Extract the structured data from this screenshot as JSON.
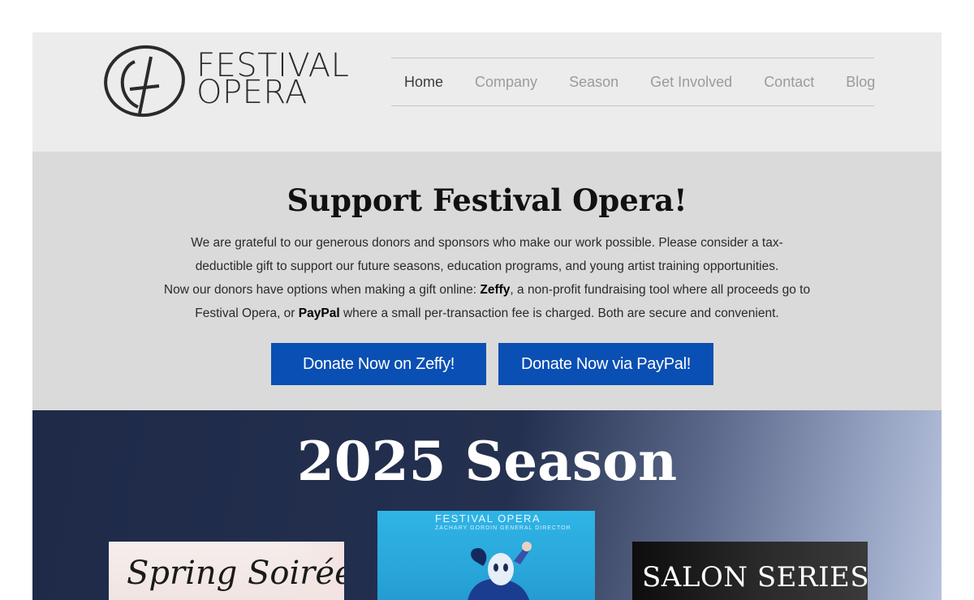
{
  "logo": {
    "line1": "FESTIVAL",
    "line2": "OPERA"
  },
  "nav": {
    "items": [
      {
        "label": "Home",
        "active": true
      },
      {
        "label": "Company"
      },
      {
        "label": "Season"
      },
      {
        "label": "Get Involved"
      },
      {
        "label": "Contact"
      },
      {
        "label": "Blog"
      }
    ]
  },
  "support": {
    "title": "Support Festival Opera!",
    "para1": "We are grateful to our generous donors and sponsors who make our work possible. Please consider a tax-deductible gift to support our future seasons, education programs, and young artist training opportunities.",
    "para2_a": "Now our donors have options when making a gift online: ",
    "para2_zeffy": "Zeffy",
    "para2_b": ", a non-profit fundraising tool where all proceeds go to Festival Opera, or ",
    "para2_paypal": "PayPal",
    "para2_c": " where a small per-transaction fee is charged. Both are secure and convenient.",
    "btn_zeffy": "Donate Now on Zeffy!",
    "btn_paypal": "Donate Now via PayPal!"
  },
  "season": {
    "title": "2025 Season",
    "cards": {
      "spring": "Spring Soirée",
      "poster_brand": "FESTIVAL OPERA",
      "poster_sub": "ZACHARY GORDIN GENERAL DIRECTOR",
      "salon": "SALON SERIES"
    }
  },
  "colors": {
    "button": "#0a4fb3",
    "header_bg": "#ececec",
    "support_bg": "#dadada",
    "season_bg": "#1e2a48"
  }
}
